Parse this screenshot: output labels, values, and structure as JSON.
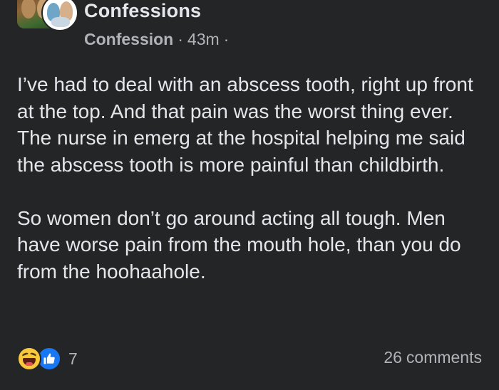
{
  "post": {
    "group_name": "Confessions",
    "category": "Confession",
    "separator": "·",
    "time_ago": "43m",
    "privacy_separator": "·",
    "paragraphs": [
      "I’ve had to deal with an abscess tooth, right up front at the top. And that pain was the worst thing ever. The nurse in emerg at the hospital helping me said the abscess tooth is more painful than childbirth.",
      "So women don’t go around acting all tough. Men have worse pain from the mouth hole, than you do from the hoohaahole."
    ]
  },
  "footer": {
    "reaction_icons": [
      "haha-reaction-icon",
      "like-reaction-icon"
    ],
    "reaction_count": "7",
    "comment_count": "26",
    "comment_label": "comments"
  },
  "colors": {
    "background": "#242526",
    "primary_text": "#e4e6eb",
    "secondary_text": "#b0b3b8",
    "like_blue": "#1877f2",
    "haha_yellow": "#f7c93b"
  }
}
